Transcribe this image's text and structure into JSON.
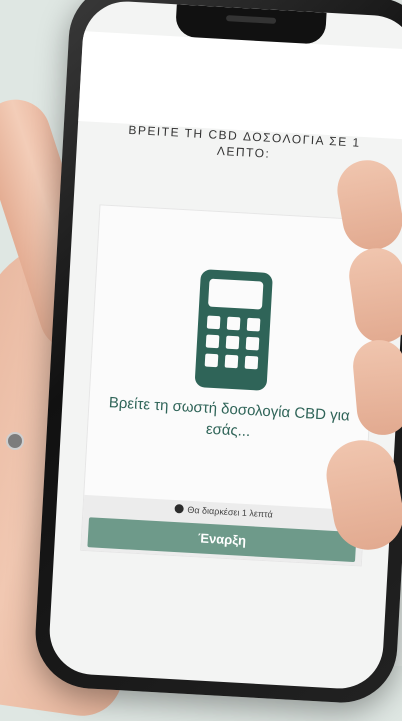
{
  "quiz": {
    "title": "ΒΡΕΙΤΕ ΤΗ CBD ΔΟΣΟΛΟΓΙΑ ΣΕ 1 ΛΕΠΤΟ:",
    "lead": "Βρείτε τη σωστή δοσολογία CBD για εσάς...",
    "duration": "Θα διαρκέσει 1 λεπτά",
    "start_label": "Έναρξη"
  },
  "icons": {
    "calculator": "calculator-icon",
    "clock": "clock-icon"
  },
  "colors": {
    "accent": "#2f6458",
    "button": "#6e9a8a",
    "background": "#dfe7e3"
  }
}
